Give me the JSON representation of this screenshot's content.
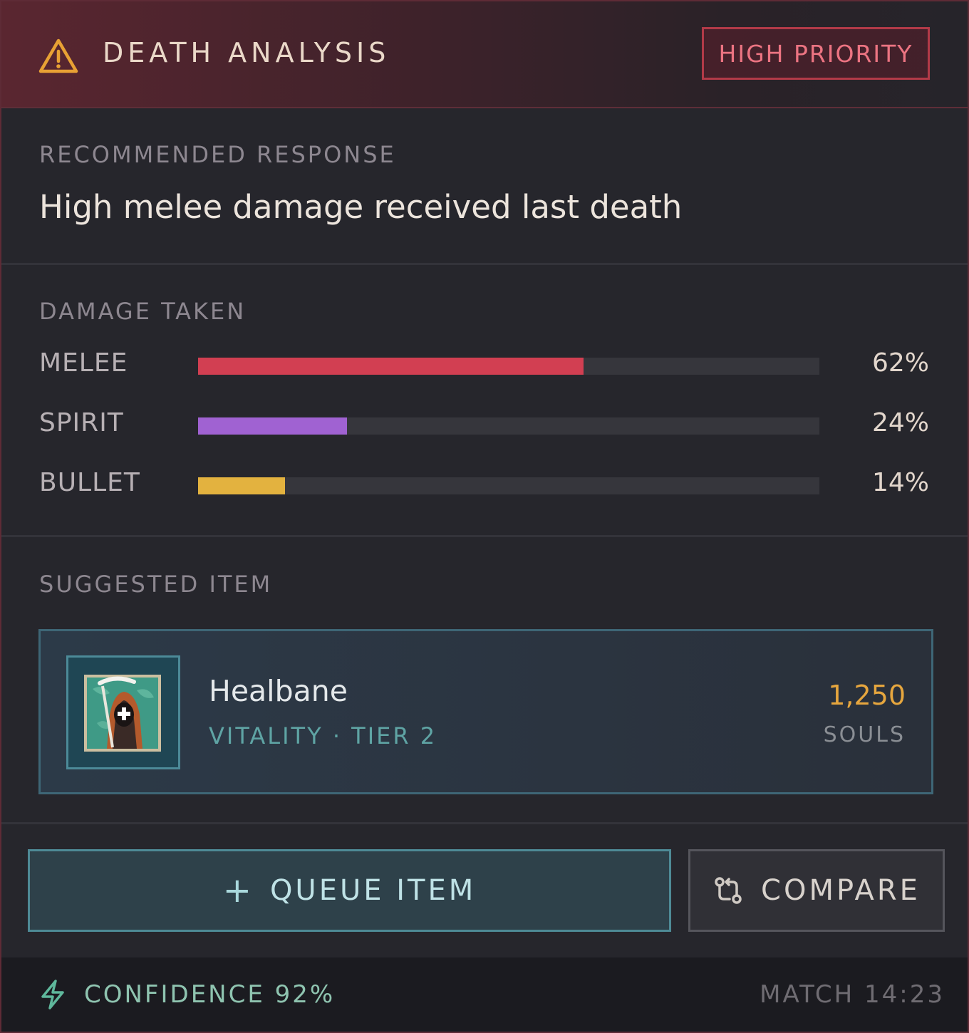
{
  "header": {
    "title": "DEATH ANALYSIS",
    "badge": "HIGH PRIORITY",
    "icon": "warning-triangle-icon"
  },
  "recommendation": {
    "label": "RECOMMENDED RESPONSE",
    "text": "High melee damage received last death"
  },
  "damage": {
    "label": "DAMAGE TAKEN",
    "rows": [
      {
        "name": "MELEE",
        "value": "62%",
        "fraction": 0.62,
        "color": "#d23f52"
      },
      {
        "name": "SPIRIT",
        "value": "24%",
        "fraction": 0.24,
        "color": "#a062d2"
      },
      {
        "name": "BULLET",
        "value": "14%",
        "fraction": 0.14,
        "color": "#e3b23f"
      }
    ]
  },
  "suggested": {
    "label": "SUGGESTED ITEM",
    "item": {
      "name": "Healbane",
      "meta": "VITALITY · TIER 2",
      "price": "1,250",
      "currency": "SOULS",
      "icon": "healbane-reaper-icon"
    }
  },
  "actions": {
    "queue_label": "QUEUE ITEM",
    "compare_label": "COMPARE"
  },
  "footer": {
    "confidence": "CONFIDENCE 92%",
    "match": "MATCH 14:23"
  },
  "colors": {
    "accent_red": "#b23a48",
    "accent_teal": "#4e8a96",
    "price": "#e6a63e"
  }
}
